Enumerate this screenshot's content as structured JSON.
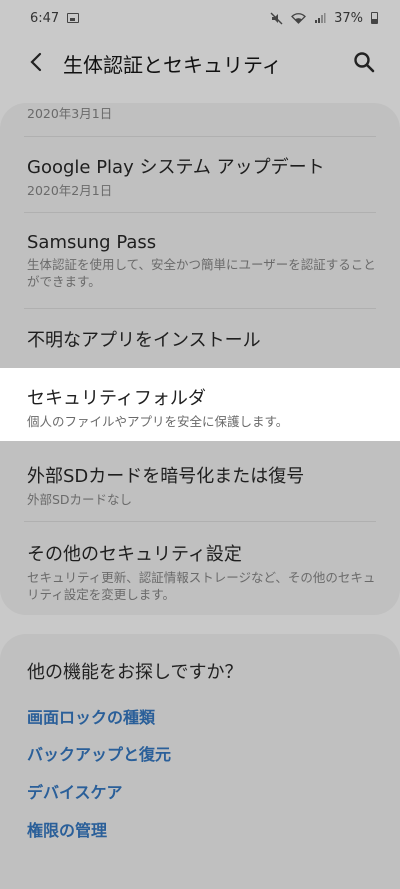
{
  "status_bar": {
    "time": "6:47",
    "battery": "37%"
  },
  "header": {
    "title": "生体認証とセキュリティ"
  },
  "main": {
    "top_date": "2020年3月1日",
    "items": [
      {
        "title": "Google Play システム アップデート",
        "sub": "2020年2月1日"
      },
      {
        "title": "Samsung Pass",
        "sub": "生体認証を使用して、安全かつ簡単にユーザーを認証することができます。"
      },
      {
        "title": "不明なアプリをインストール",
        "sub": ""
      },
      {
        "title": "セキュリティフォルダ",
        "sub": "個人のファイルやアプリを安全に保護します。"
      },
      {
        "title": "外部SDカードを暗号化または復号",
        "sub": "外部SDカードなし"
      },
      {
        "title": "その他のセキュリティ設定",
        "sub": "セキュリティ更新、認証情報ストレージなど、その他のセキュリティ設定を変更します。"
      }
    ]
  },
  "other": {
    "title": "他の機能をお探しですか？",
    "links": [
      "画面ロックの種類",
      "バックアップと復元",
      "デバイスケア",
      "権限の管理"
    ]
  },
  "colors": {
    "link": "#2a5f99",
    "highlight": "#ffffff",
    "dim_background": "#c9c9c9"
  }
}
